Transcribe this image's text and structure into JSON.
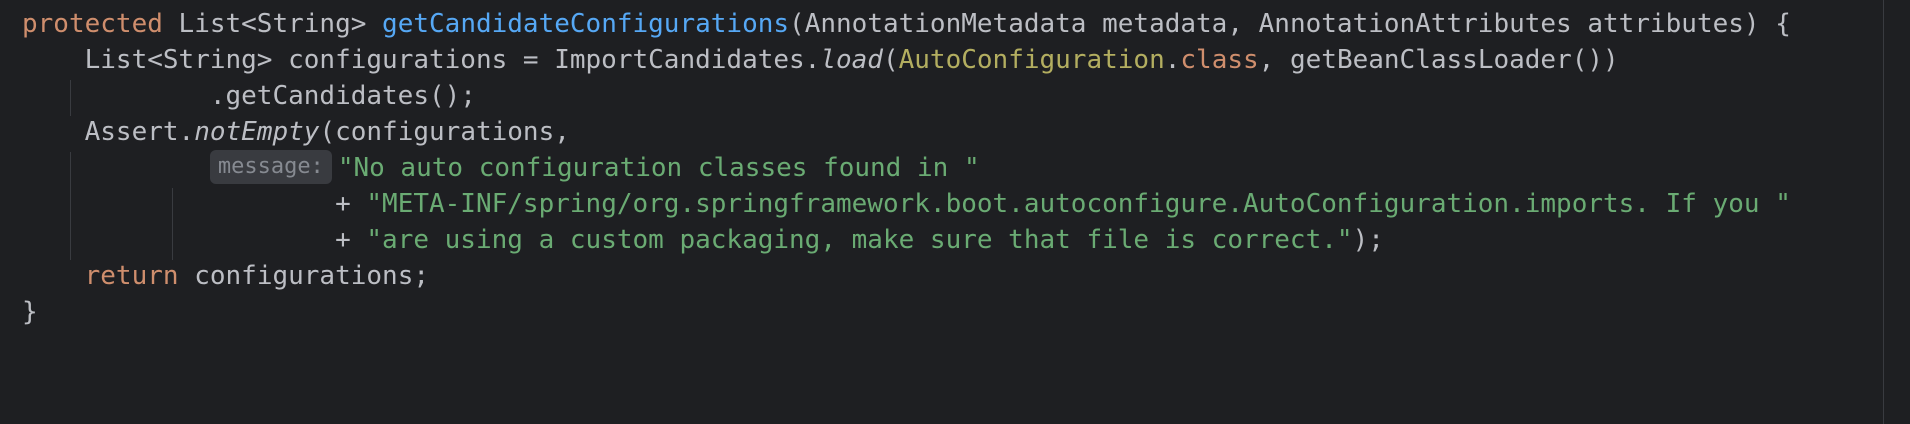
{
  "code": {
    "l1": {
      "kw_protected": "protected",
      "type_ret": " List<String> ",
      "method": "getCandidateConfigurations",
      "params": "(AnnotationMetadata metadata, AnnotationAttributes attributes) {"
    },
    "l2": {
      "lhs": "List<String> configurations = ImportCandidates.",
      "load": "load",
      "open": "(",
      "cls": "AutoConfiguration",
      "dot": ".",
      "kw_class": "class",
      "rest": ", getBeanClassLoader())"
    },
    "l3": {
      "text": ".getCandidates();"
    },
    "l4": {
      "pre": "Assert.",
      "call": "notEmpty",
      "rest": "(configurations,"
    },
    "l5": {
      "hint": "message:",
      "str": "\"No auto configuration classes found in \""
    },
    "l6": {
      "plus": "+ ",
      "str": "\"META-INF/spring/org.springframework.boot.autoconfigure.AutoConfiguration.imports. If you \""
    },
    "l7": {
      "plus": "+ ",
      "str": "\"are using a custom packaging, make sure that file is correct.\"",
      "end": ");"
    },
    "l8": {
      "kw_return": "return",
      "rest": " configurations;"
    },
    "l9": {
      "text": "}"
    }
  },
  "colors": {
    "background": "#1e1f22",
    "default_text": "#bcbec4",
    "keyword": "#cf8e6d",
    "method_declaration": "#56a8f5",
    "string": "#6aab73",
    "class_reference": "#b3ae60",
    "inlay_hint": "#868a91"
  }
}
